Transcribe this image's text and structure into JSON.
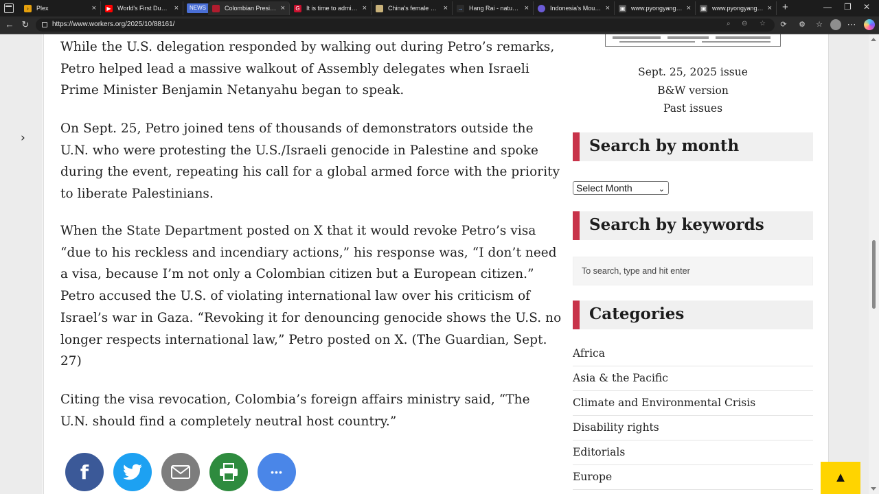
{
  "browser": {
    "tabs": [
      {
        "title": "Plex",
        "fav": "›",
        "fav_color": "#e5a00d"
      },
      {
        "title": "World's First Dual-Touch",
        "fav": "▶",
        "fav_color": "#ff0000"
      },
      {
        "title": "Colombian President",
        "fav": "",
        "fav_color": "#b01c2e"
      },
      {
        "title": "It is time to admit Pal",
        "fav": "G",
        "fav_color": "#c8102e"
      },
      {
        "title": "China's female astron",
        "fav": "",
        "fav_color": "#c9b27a"
      },
      {
        "title": "Hang Rai - natural ge",
        "fav": "→",
        "fav_color": "#2b2b2b"
      },
      {
        "title": "Indonesia's Mount Le",
        "fav": "",
        "fav_color": "#6b5bd6"
      },
      {
        "title": "www.pyongyangtime",
        "fav": "▣",
        "fav_color": "#555555"
      },
      {
        "title": "www.pyongyangtime",
        "fav": "▣",
        "fav_color": "#555555"
      }
    ],
    "news_badge": "NEWS",
    "url": "https://www.workers.org/2025/10/88161/"
  },
  "article": {
    "paragraphs": [
      "While the U.S. delegation responded by walking out during Petro’s remarks, Petro helped lead a massive walkout of Assembly delegates when Israeli Prime Minister Benjamin Netanyahu began to speak.",
      "On Sept. 25, Petro joined tens of thousands of demonstrators outside the U.N. who were protesting the U.S./Israeli genocide in Palestine and spoke during the event, repeating his call for a global armed force with the priority to liberate Palestinians.",
      "When the State Department posted on X that it would revoke Petro’s visa “due to his reckless and incendiary actions,” his response was, “I don’t need a visa, because I’m not only a Colombian citizen but a European citizen.” Petro accused the U.S. of violating international law over his criticism of Israel’s war in Gaza. “Revoking it for denouncing genocide shows the U.S. no longer respects international law,” Petro posted on X. (The Guardian, Sept. 27)",
      "Citing the visa revocation, Colombia’s foreign affairs ministry said, “The U.N. should find a completely neutral host country.”"
    ]
  },
  "share": {
    "buttons": [
      {
        "name": "facebook",
        "glyph": "f",
        "color": "#3b5998"
      },
      {
        "name": "twitter",
        "glyph": "",
        "color": "#1da1f2"
      },
      {
        "name": "email",
        "glyph": "",
        "color": "#7d7d7d"
      },
      {
        "name": "print",
        "glyph": "",
        "color": "#2e8b3e"
      },
      {
        "name": "more",
        "glyph": "•••",
        "color": "#4a86e8"
      }
    ]
  },
  "sidebar": {
    "issue_links": [
      "Sept. 25, 2025 issue",
      "B&W version",
      "Past issues"
    ],
    "search_by_month": {
      "title": "Search by month",
      "select_value": "Select Month"
    },
    "search_by_keywords": {
      "title": "Search by keywords",
      "placeholder": "To search, type and hit enter"
    },
    "categories": {
      "title": "Categories",
      "items": [
        "Africa",
        "Asia & the Pacific",
        "Climate and Environmental Crisis",
        "Disability rights",
        "Editorials",
        "Europe"
      ]
    },
    "accent_color": "#c8334a"
  },
  "back_to_top": "▲"
}
